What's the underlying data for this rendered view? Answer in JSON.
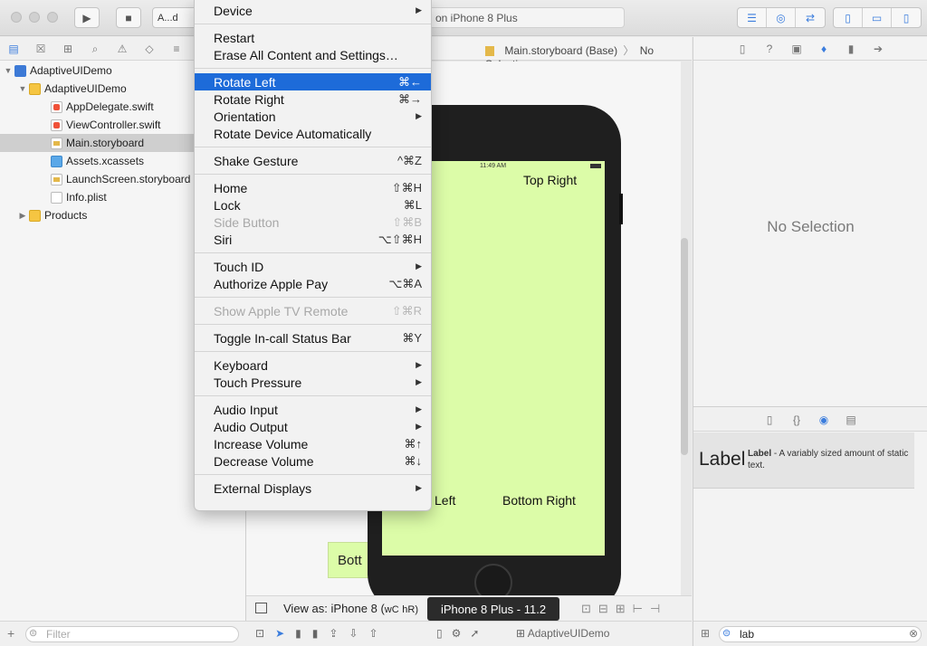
{
  "toolbar": {
    "run_icon": "play-icon",
    "stop_icon": "stop-icon",
    "scheme_label": "A...d",
    "activity_text": "on iPhone 8 Plus"
  },
  "navigator": {
    "items": [
      {
        "label": "AdaptiveUIDemo",
        "icon": "project-icon"
      },
      {
        "label": "AdaptiveUIDemo",
        "icon": "folder-icon"
      },
      {
        "label": "AppDelegate.swift",
        "icon": "swift-file-icon"
      },
      {
        "label": "ViewController.swift",
        "icon": "swift-file-icon"
      },
      {
        "label": "Main.storyboard",
        "icon": "storyboard-icon"
      },
      {
        "label": "Assets.xcassets",
        "icon": "assets-icon"
      },
      {
        "label": "LaunchScreen.storyboard",
        "icon": "storyboard-icon"
      },
      {
        "label": "Info.plist",
        "icon": "plist-icon"
      },
      {
        "label": "Products",
        "icon": "folder-icon"
      }
    ],
    "filter_placeholder": "Filter"
  },
  "editor": {
    "breadcrumb_file": "Main.storyboard (Base)",
    "breadcrumb_selection": "No Selection",
    "status_time": "11:49 AM",
    "label_top_left_fragment": "t",
    "label_top_right": "Top Right",
    "label_bottom_left_fragment": "Left",
    "label_bottom_right": "Bottom Right",
    "label_small_fragment": "Bott",
    "view_as_prefix": "View as: iPhone 8 (",
    "view_as_w": "wC",
    "view_as_h": "hR)",
    "tooltip": "iPhone 8 Plus - 11.2",
    "bottom_scene": "AdaptiveUIDemo"
  },
  "inspector": {
    "no_selection": "No Selection",
    "library_item_title": "Label",
    "library_item_name": "Label",
    "library_item_desc": " - A variably sized amount of static text.",
    "library_search": "lab"
  },
  "menu": {
    "items": [
      {
        "label": "Device",
        "shortcut": "",
        "submenu": true,
        "disabled": false,
        "highlighted": false
      },
      {
        "sep": true
      },
      {
        "label": "Restart",
        "shortcut": "",
        "submenu": false,
        "disabled": false,
        "highlighted": false
      },
      {
        "label": "Erase All Content and Settings…",
        "shortcut": "",
        "submenu": false,
        "disabled": false,
        "highlighted": false
      },
      {
        "sep": true
      },
      {
        "label": "Rotate Left",
        "shortcut": "⌘←",
        "submenu": false,
        "disabled": false,
        "highlighted": true
      },
      {
        "label": "Rotate Right",
        "shortcut": "⌘→",
        "submenu": false,
        "disabled": false,
        "highlighted": false
      },
      {
        "label": "Orientation",
        "shortcut": "",
        "submenu": true,
        "disabled": false,
        "highlighted": false
      },
      {
        "label": "Rotate Device Automatically",
        "shortcut": "",
        "submenu": false,
        "disabled": false,
        "highlighted": false
      },
      {
        "sep": true
      },
      {
        "label": "Shake Gesture",
        "shortcut": "^⌘Z",
        "submenu": false,
        "disabled": false,
        "highlighted": false
      },
      {
        "sep": true
      },
      {
        "label": "Home",
        "shortcut": "⇧⌘H",
        "submenu": false,
        "disabled": false,
        "highlighted": false
      },
      {
        "label": "Lock",
        "shortcut": "⌘L",
        "submenu": false,
        "disabled": false,
        "highlighted": false
      },
      {
        "label": "Side Button",
        "shortcut": "⇧⌘B",
        "submenu": false,
        "disabled": true,
        "highlighted": false
      },
      {
        "label": "Siri",
        "shortcut": "⌥⇧⌘H",
        "submenu": false,
        "disabled": false,
        "highlighted": false
      },
      {
        "sep": true
      },
      {
        "label": "Touch ID",
        "shortcut": "",
        "submenu": true,
        "disabled": false,
        "highlighted": false
      },
      {
        "label": "Authorize Apple Pay",
        "shortcut": "⌥⌘A",
        "submenu": false,
        "disabled": false,
        "highlighted": false
      },
      {
        "sep": true
      },
      {
        "label": "Show Apple TV Remote",
        "shortcut": "⇧⌘R",
        "submenu": false,
        "disabled": true,
        "highlighted": false
      },
      {
        "sep": true
      },
      {
        "label": "Toggle In-call Status Bar",
        "shortcut": "⌘Y",
        "submenu": false,
        "disabled": false,
        "highlighted": false
      },
      {
        "sep": true
      },
      {
        "label": "Keyboard",
        "shortcut": "",
        "submenu": true,
        "disabled": false,
        "highlighted": false
      },
      {
        "label": "Touch Pressure",
        "shortcut": "",
        "submenu": true,
        "disabled": false,
        "highlighted": false
      },
      {
        "sep": true
      },
      {
        "label": "Audio Input",
        "shortcut": "",
        "submenu": true,
        "disabled": false,
        "highlighted": false
      },
      {
        "label": "Audio Output",
        "shortcut": "",
        "submenu": true,
        "disabled": false,
        "highlighted": false
      },
      {
        "label": "Increase Volume",
        "shortcut": "⌘↑",
        "submenu": false,
        "disabled": false,
        "highlighted": false
      },
      {
        "label": "Decrease Volume",
        "shortcut": "⌘↓",
        "submenu": false,
        "disabled": false,
        "highlighted": false
      },
      {
        "sep": true
      },
      {
        "label": "External Displays",
        "shortcut": "",
        "submenu": true,
        "disabled": false,
        "highlighted": false
      }
    ]
  },
  "colors": {
    "highlight": "#1d6bd9",
    "canvas_green": "#dcfca8",
    "phone_body": "#1f1f1f"
  }
}
